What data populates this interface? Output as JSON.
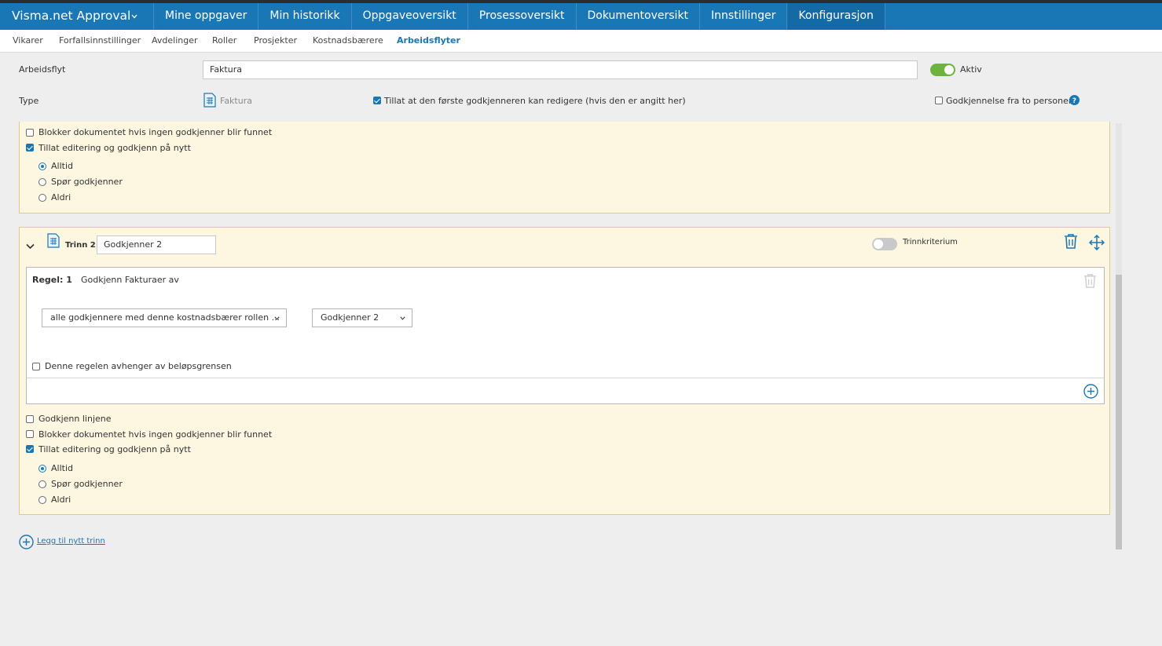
{
  "app": {
    "title": "Visma.net Approval"
  },
  "nav": {
    "items": [
      "Mine oppgaver",
      "Min historikk",
      "Oppgaveoversikt",
      "Prosessoversikt",
      "Dokumentoversikt",
      "Innstillinger",
      "Konfigurasjon"
    ]
  },
  "subnav": {
    "items": [
      "Vikarer",
      "Forfallsinnstillinger",
      "Avdelinger",
      "Roller",
      "Prosjekter",
      "Kostnadsbærere",
      "Arbeidsflyter"
    ],
    "active": "Arbeidsflyter"
  },
  "workflow": {
    "label": "Arbeidsflyt",
    "name_value": "Faktura",
    "active_label": "Aktiv",
    "active": true,
    "type_label": "Type",
    "type_value": "Faktura",
    "allow_first_edit_label": "Tillat at den første godkjenneren kan redigere (hvis den er angitt her)",
    "allow_first_edit": true,
    "two_person_label": "Godkjennelse fra to personer",
    "two_person": false
  },
  "step1": {
    "block_label": "Blokker dokumentet hvis ingen godkjenner blir funnet",
    "block": false,
    "allow_edit_label": "Tillat editering og godkjenn på nytt",
    "allow_edit": true,
    "options": [
      "Alltid",
      "Spør godkjenner",
      "Aldri"
    ],
    "selected": "Alltid"
  },
  "step2": {
    "step_label": "Trinn 2 :",
    "name_value": "Godkjenner 2",
    "criterion_label": "Trinnkriterium",
    "criterion": false,
    "rule": {
      "label": "Regel: 1",
      "description": "Godkjenn Fakturaer av",
      "approver_select": "alle godkjennere med denne kostnadsbærer rollen ...",
      "role_select": "Godkjenner 2",
      "depends_label": "Denne regelen avhenger av beløpsgrensen",
      "depends": false
    },
    "approve_lines_label": "Godkjenn linjene",
    "approve_lines": false,
    "block_label": "Blokker dokumentet hvis ingen godkjenner blir funnet",
    "block": false,
    "allow_edit_label": "Tillat editering og godkjenn på nytt",
    "allow_edit": true,
    "options": [
      "Alltid",
      "Spør godkjenner",
      "Aldri"
    ],
    "selected": "Alltid"
  },
  "add_step_label": "Legg til nytt trinn",
  "colors": {
    "primary": "#1a77b5",
    "toggle_on": "#6cb33f",
    "panel_bg": "#fdf6e0",
    "panel_border": "#e2c98b"
  }
}
